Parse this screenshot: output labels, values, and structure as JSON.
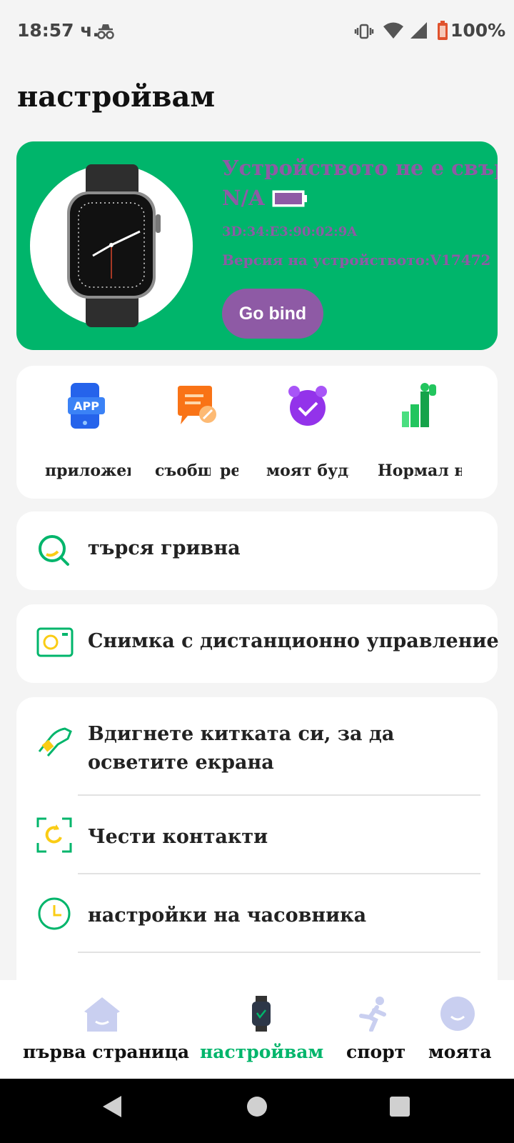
{
  "status_bar": {
    "time": "18:57 ч.",
    "battery": "100%"
  },
  "header": {
    "title": "настройвам"
  },
  "device": {
    "status": "Устройството не е свързано",
    "name": "N/A",
    "mac": "3D:34:E3:90:02:9A",
    "version": "Версия на устройството:V17472",
    "bind_label": "Go bind"
  },
  "quick_actions": [
    {
      "label": "приложението",
      "icon": "app-icon"
    },
    {
      "label": "съобщенията",
      "icon": "message-icon"
    },
    {
      "label": "ре",
      "icon": ""
    },
    {
      "label": "моят будилник",
      "icon": "alarm-clock-icon"
    },
    {
      "label": "Нормал начин",
      "icon": "fitness-icon"
    }
  ],
  "rows": {
    "find_band": "търся гривна",
    "remote_photo": "Снимка с дистанционно управление"
  },
  "settings_list": [
    {
      "label": "Вдигнете китката си, за да осветите екрана",
      "icon": "raise-wrist-icon"
    },
    {
      "label": "Чести контакти",
      "icon": "contacts-sync-icon"
    },
    {
      "label": "настройки на часовника",
      "icon": "clock-icon"
    }
  ],
  "bottom_nav": [
    {
      "label": "първа страница",
      "icon": "home-icon",
      "active": false
    },
    {
      "label": "настройвам",
      "icon": "watch-icon",
      "active": true
    },
    {
      "label": "спорт",
      "icon": "running-icon",
      "active": false
    },
    {
      "label": "моята",
      "icon": "profile-icon",
      "active": false
    }
  ],
  "colors": {
    "accent": "#00b56b",
    "purple": "#8e5aa5",
    "background": "#f4f4f4"
  }
}
